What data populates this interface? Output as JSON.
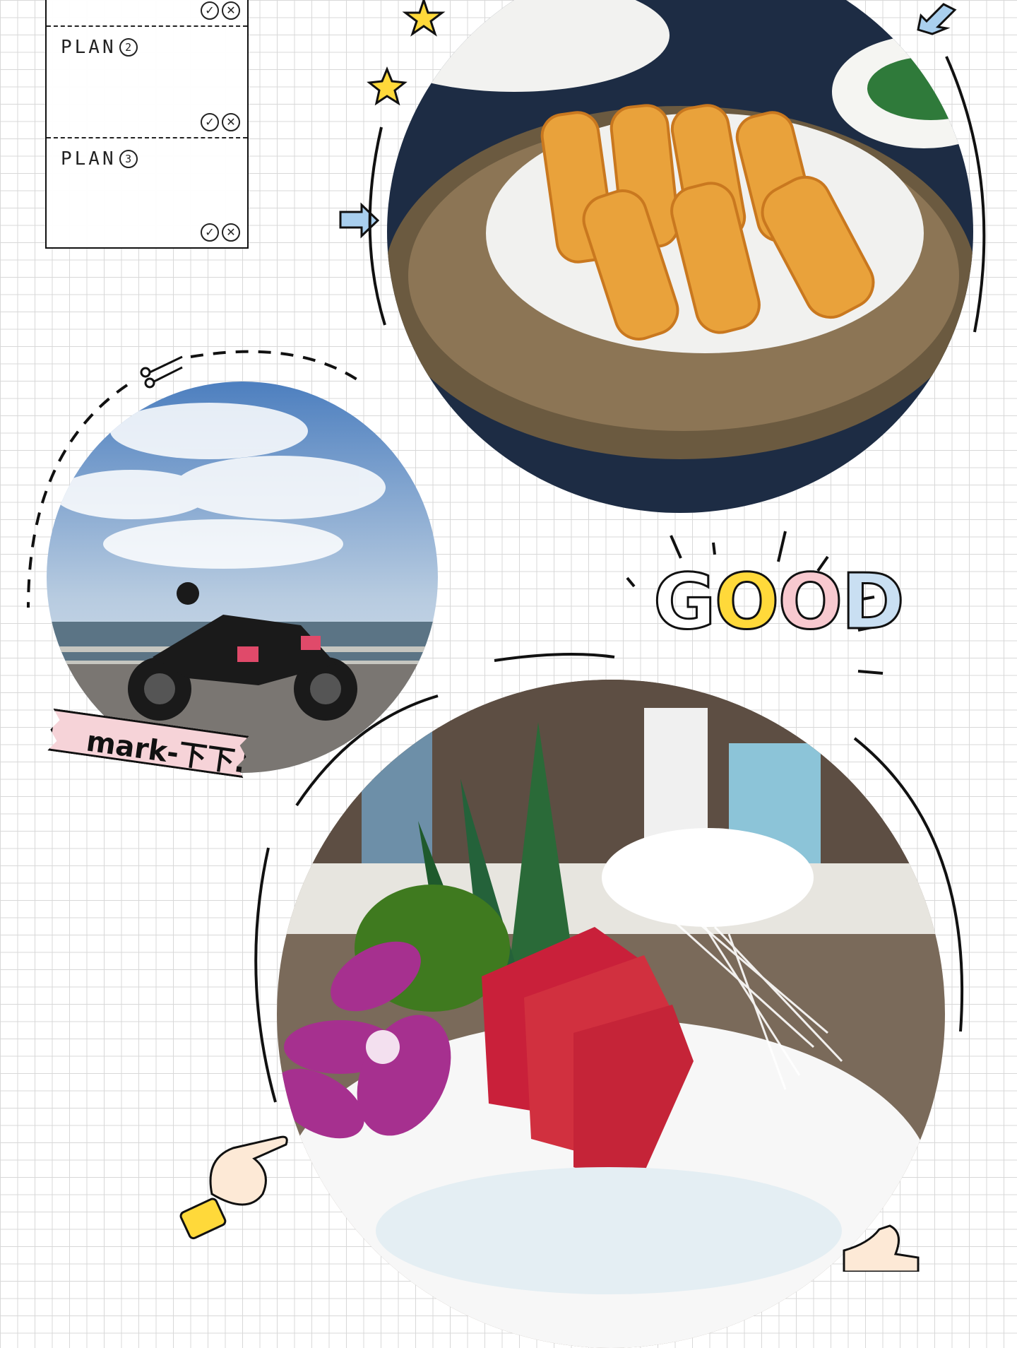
{
  "planner": {
    "plans": [
      {
        "label": "PLAN",
        "number": "2"
      },
      {
        "label": "PLAN",
        "number": "3"
      }
    ],
    "check_mark": "✓",
    "cross_mark": "✕"
  },
  "sticker": {
    "text": "mark-下下."
  },
  "good_sticker": {
    "letters": [
      "G",
      "O",
      "O",
      "D"
    ]
  },
  "colors": {
    "accent_yellow": "#ffd93a",
    "accent_pink": "#f8c9cf",
    "accent_blue": "#c9dff2",
    "arrow_blue": "#a9cfee"
  },
  "icons": [
    "star-icon",
    "arrow-icon",
    "scissors-icon",
    "pointing-hand-icon",
    "thumbs-up-icon"
  ]
}
